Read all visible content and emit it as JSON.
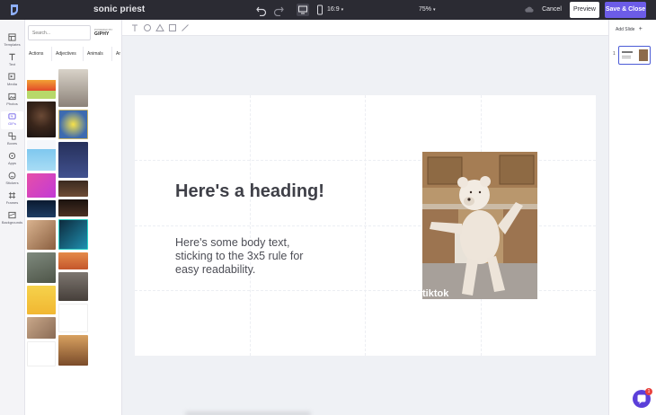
{
  "topbar": {
    "title": "sonic priest",
    "aspect": "16:9",
    "zoom": "75%",
    "cancel_label": "Cancel",
    "preview_label": "Preview",
    "save_label": "Save & Close"
  },
  "rail": {
    "items": [
      {
        "label": "Templates",
        "icon": "templates-icon"
      },
      {
        "label": "Text",
        "icon": "text-icon"
      },
      {
        "label": "Media",
        "icon": "media-icon"
      },
      {
        "label": "Photos",
        "icon": "photos-icon"
      },
      {
        "label": "GIFs",
        "icon": "gif-icon"
      },
      {
        "label": "Boxes",
        "icon": "boxes-icon"
      },
      {
        "label": "Apps",
        "icon": "apps-icon"
      },
      {
        "label": "Stickers",
        "icon": "stickers-icon"
      },
      {
        "label": "Frames",
        "icon": "frames-icon"
      },
      {
        "label": "Backgrounds",
        "icon": "backgrounds-icon"
      }
    ]
  },
  "panel": {
    "search_placeholder": "Search...",
    "powered_by": "POWERED BY",
    "giphy": "GIPHY",
    "categories": [
      "Actions",
      "Adjectives",
      "Animals",
      "Ar"
    ]
  },
  "canvas_tools": [
    "text-tool-icon",
    "circle-tool-icon",
    "triangle-tool-icon",
    "square-tool-icon",
    "line-tool-icon"
  ],
  "slide": {
    "heading": "Here's a heading!",
    "body": "Here's some body text, sticking to the 3x5 rule for easy readability.",
    "watermark": "tiktok"
  },
  "right_panel": {
    "add_slide_label": "Add Slide",
    "thumb_number": "1"
  },
  "chat": {
    "badge": "1"
  },
  "colors": {
    "accent": "#6c5ce7",
    "topbar": "#2b2b33",
    "thumb_border": "#4b5bd6"
  }
}
